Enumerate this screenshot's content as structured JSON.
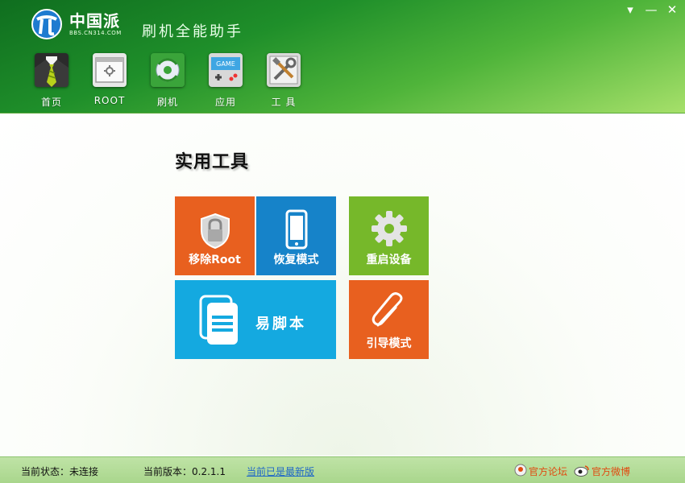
{
  "header": {
    "logo_text": "中国派",
    "logo_subtext": "BBS.CN314.COM",
    "app_title": "刷机全能助手",
    "window_buttons": {
      "menu": "▾",
      "minimize": "—",
      "close": "✕"
    }
  },
  "nav": {
    "items": [
      {
        "label": "首页",
        "icon": "suit-tie-icon"
      },
      {
        "label": "ROOT",
        "icon": "root-window-icon"
      },
      {
        "label": "刷机",
        "icon": "flash-disc-icon"
      },
      {
        "label": "应用",
        "icon": "game-app-icon"
      },
      {
        "label": "工 具",
        "icon": "tools-icon"
      }
    ]
  },
  "main": {
    "section_title": "实用工具",
    "tiles": {
      "remove_root": {
        "label": "移除Root",
        "color": "#e8601f",
        "icon": "lock-shield-icon"
      },
      "recovery_mode": {
        "label": "恢复模式",
        "color": "#1683c9",
        "icon": "phone-icon"
      },
      "reboot_device": {
        "label": "重启设备",
        "color": "#76b82a",
        "icon": "gear-icon"
      },
      "easy_script": {
        "label": "易脚本",
        "color": "#14a9e0",
        "icon": "document-icon"
      },
      "boot_mode": {
        "label": "引导模式",
        "color": "#e8601f",
        "icon": "paperclip-icon"
      }
    }
  },
  "status": {
    "connection": "当前状态：未连接",
    "version": "当前版本：0.2.1.1",
    "update_link": "当前已是最新版",
    "forum_link": "官方论坛",
    "weibo_link": "官方微博"
  }
}
